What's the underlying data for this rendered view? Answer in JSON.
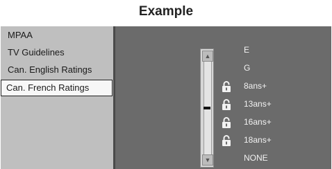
{
  "title": "Example",
  "menu": {
    "items": [
      {
        "label": "MPAA",
        "selected": false
      },
      {
        "label": "TV Guidelines",
        "selected": false
      },
      {
        "label": "Can. English Ratings",
        "selected": false
      },
      {
        "label": "Can. French Ratings",
        "selected": true
      }
    ]
  },
  "scrollbar": {
    "up_icon": "triangle-up",
    "down_icon": "triangle-down",
    "level": 0.5
  },
  "ratings": [
    {
      "label": "E",
      "locked": false
    },
    {
      "label": "G",
      "locked": false
    },
    {
      "label": "8ans+",
      "locked": true
    },
    {
      "label": "13ans+",
      "locked": true
    },
    {
      "label": "16ans+",
      "locked": true
    },
    {
      "label": "18ans+",
      "locked": true
    },
    {
      "label": "NONE",
      "locked": false
    }
  ],
  "colors": {
    "panel_bg": "#6b6b6b",
    "menu_bg": "#bfbfbf",
    "selected_bg": "#f7f7f7",
    "lock_color": "#f2f2f2"
  }
}
